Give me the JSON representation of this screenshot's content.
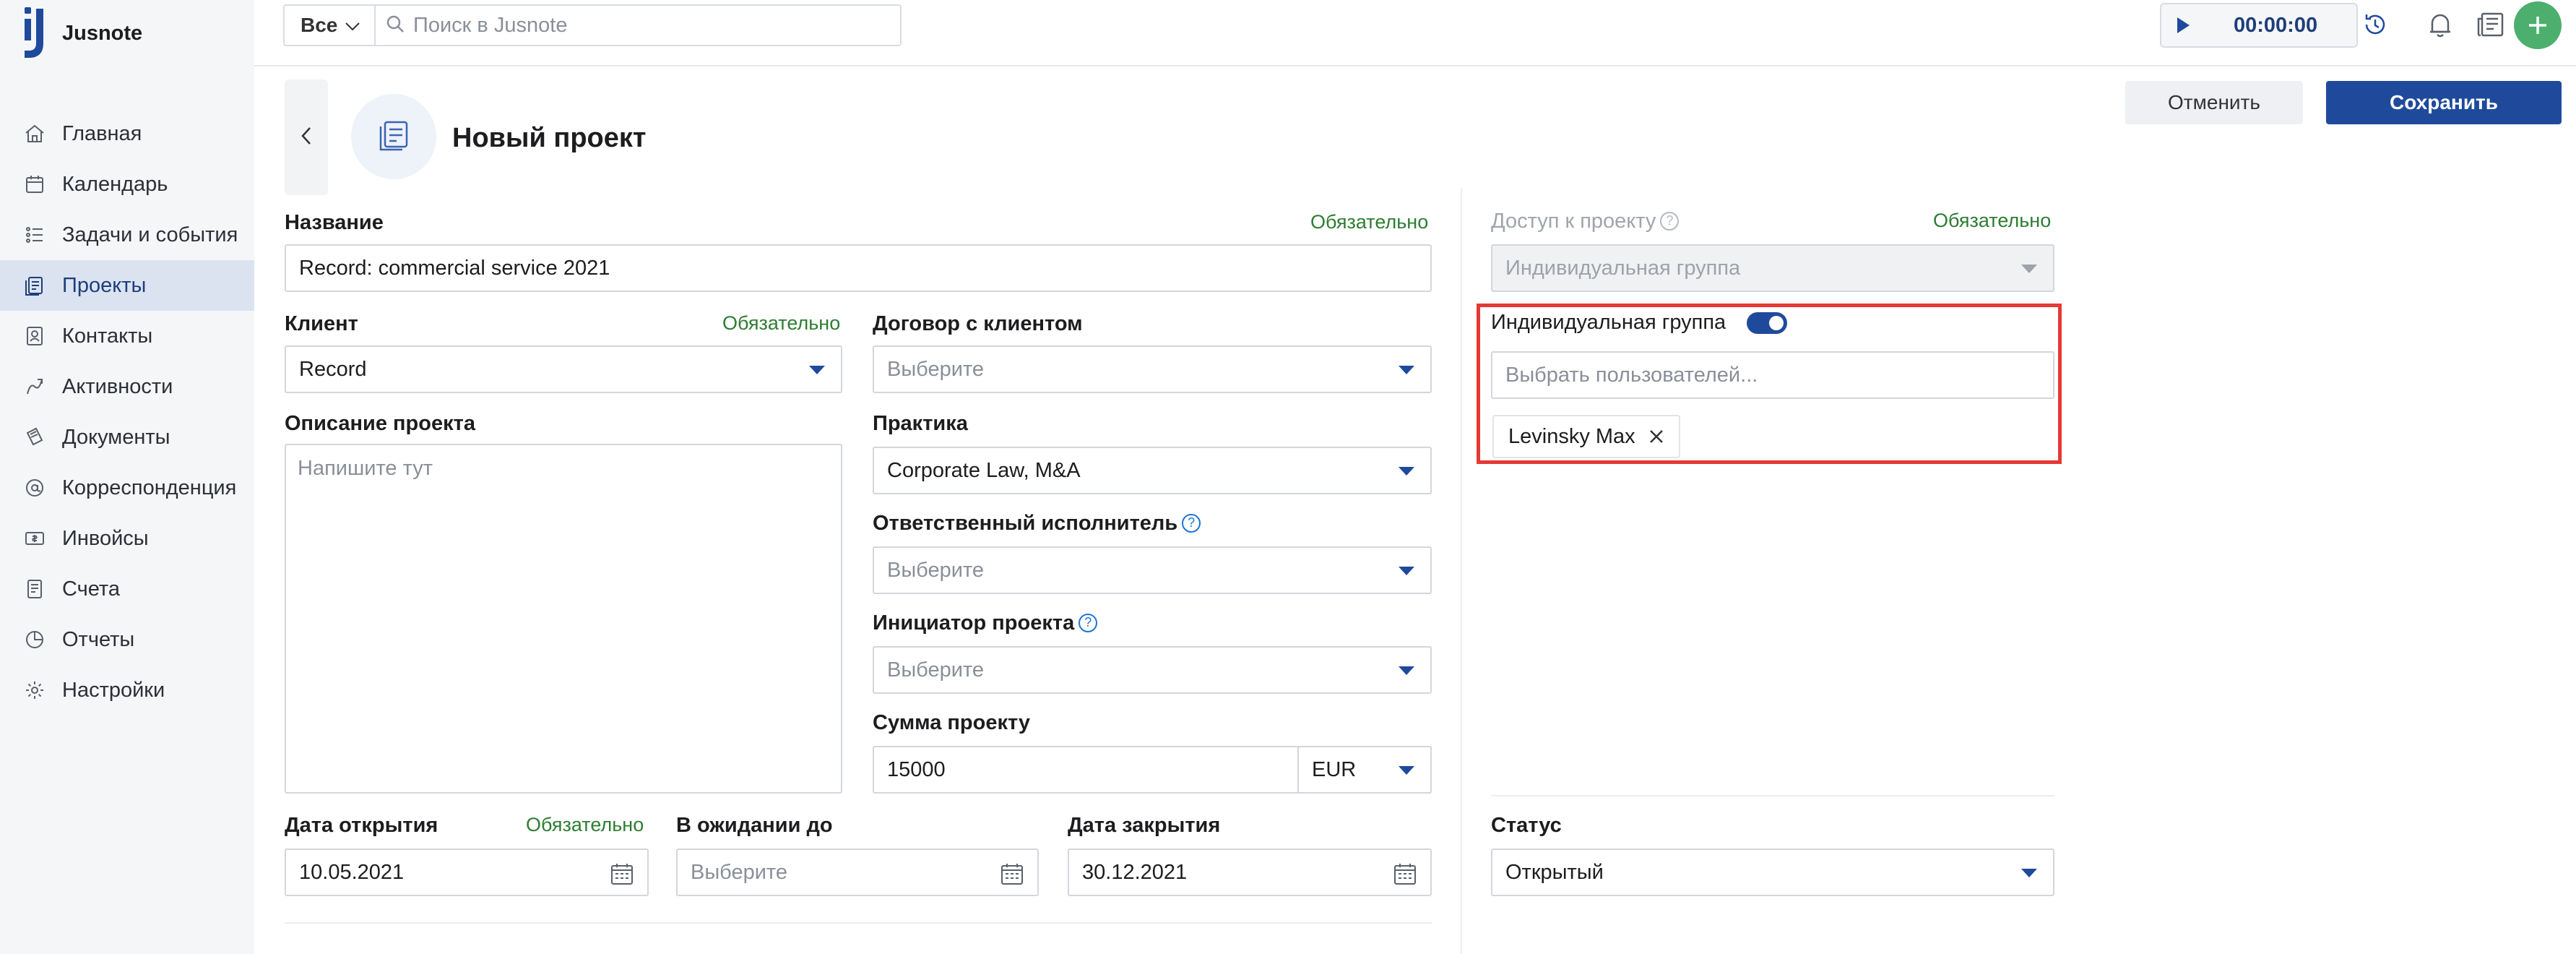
{
  "app": {
    "brand": "Jusnote",
    "colors": {
      "accent": "#1f4a9c",
      "active_bg": "#dbe3f1",
      "required": "#2e7d32",
      "add": "#4caf6e",
      "highlight": "#e53935"
    }
  },
  "sidebar": {
    "items": [
      {
        "label": "Главная",
        "icon": "home-icon",
        "active": false
      },
      {
        "label": "Календарь",
        "icon": "calendar-icon",
        "active": false
      },
      {
        "label": "Задачи и события",
        "icon": "tasks-icon",
        "active": false
      },
      {
        "label": "Проекты",
        "icon": "projects-icon",
        "active": true
      },
      {
        "label": "Контакты",
        "icon": "contacts-icon",
        "active": false
      },
      {
        "label": "Активности",
        "icon": "activity-icon",
        "active": false
      },
      {
        "label": "Документы",
        "icon": "documents-icon",
        "active": false
      },
      {
        "label": "Корреспонденция",
        "icon": "mail-icon",
        "active": false
      },
      {
        "label": "Инвойсы",
        "icon": "invoice-icon",
        "active": false
      },
      {
        "label": "Счета",
        "icon": "accounts-icon",
        "active": false
      },
      {
        "label": "Отчеты",
        "icon": "reports-icon",
        "active": false
      },
      {
        "label": "Настройки",
        "icon": "settings-icon",
        "active": false
      }
    ]
  },
  "topbar": {
    "filter_label": "Все",
    "search_placeholder": "Поиск в Jusnote",
    "timer": "00:00:00"
  },
  "header": {
    "title": "Новый проект",
    "cancel_label": "Отменить",
    "save_label": "Сохранить"
  },
  "form": {
    "required_text": "Обязательно",
    "name": {
      "label": "Название",
      "value": "Record: commercial service 2021"
    },
    "client": {
      "label": "Клиент",
      "value": "Record"
    },
    "contract": {
      "label": "Договор с клиентом",
      "placeholder": "Выберите"
    },
    "description": {
      "label": "Описание проекта",
      "placeholder": "Напишите тут"
    },
    "practice": {
      "label": "Практика",
      "value": "Corporate Law, M&A"
    },
    "responsible": {
      "label": "Ответственный исполнитель",
      "placeholder": "Выберите"
    },
    "initiator": {
      "label": "Инициатор проекта",
      "placeholder": "Выберите"
    },
    "amount": {
      "label": "Сумма проекту",
      "value": "15000",
      "currency": "EUR"
    },
    "open_date": {
      "label": "Дата открытия",
      "value": "10.05.2021"
    },
    "pending_until": {
      "label": "В ожидании до",
      "placeholder": "Выберите"
    },
    "close_date": {
      "label": "Дата закрытия",
      "value": "30.12.2021"
    },
    "access": {
      "label": "Доступ к проекту",
      "value": "Индивидуальная группа"
    },
    "individual_group": {
      "label": "Индивидуальная группа",
      "enabled": true,
      "users_placeholder": "Выбрать пользователей...",
      "users": [
        "Levinsky Max"
      ]
    },
    "status": {
      "label": "Статус",
      "value": "Открытый"
    }
  }
}
